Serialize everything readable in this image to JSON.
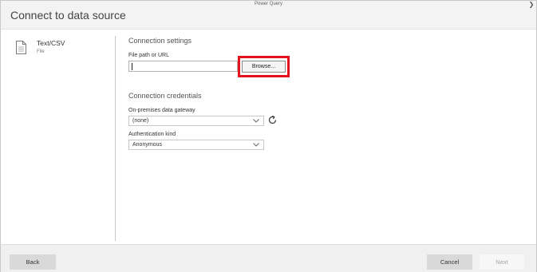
{
  "window": {
    "app_title": "Power Query",
    "dialog_title": "Connect to data source",
    "close_glyph": "❯"
  },
  "sidebar": {
    "source": {
      "name": "Text/CSV",
      "type": "File",
      "icon": "file-icon"
    }
  },
  "connection_settings": {
    "heading": "Connection settings",
    "file_path_label": "File path or URL",
    "file_path_value": "",
    "browse_label": "Browse..."
  },
  "connection_credentials": {
    "heading": "Connection credentials",
    "gateway_label": "On-premises data gateway",
    "gateway_value": "(none)",
    "auth_label": "Authentication kind",
    "auth_value": "Anonymous"
  },
  "footer": {
    "back_label": "Back",
    "cancel_label": "Cancel",
    "next_label": "Next"
  },
  "colors": {
    "highlight": "#e3121b",
    "footer_bg": "#f0f0f0",
    "titlebar_bg": "#f3f3f3"
  }
}
